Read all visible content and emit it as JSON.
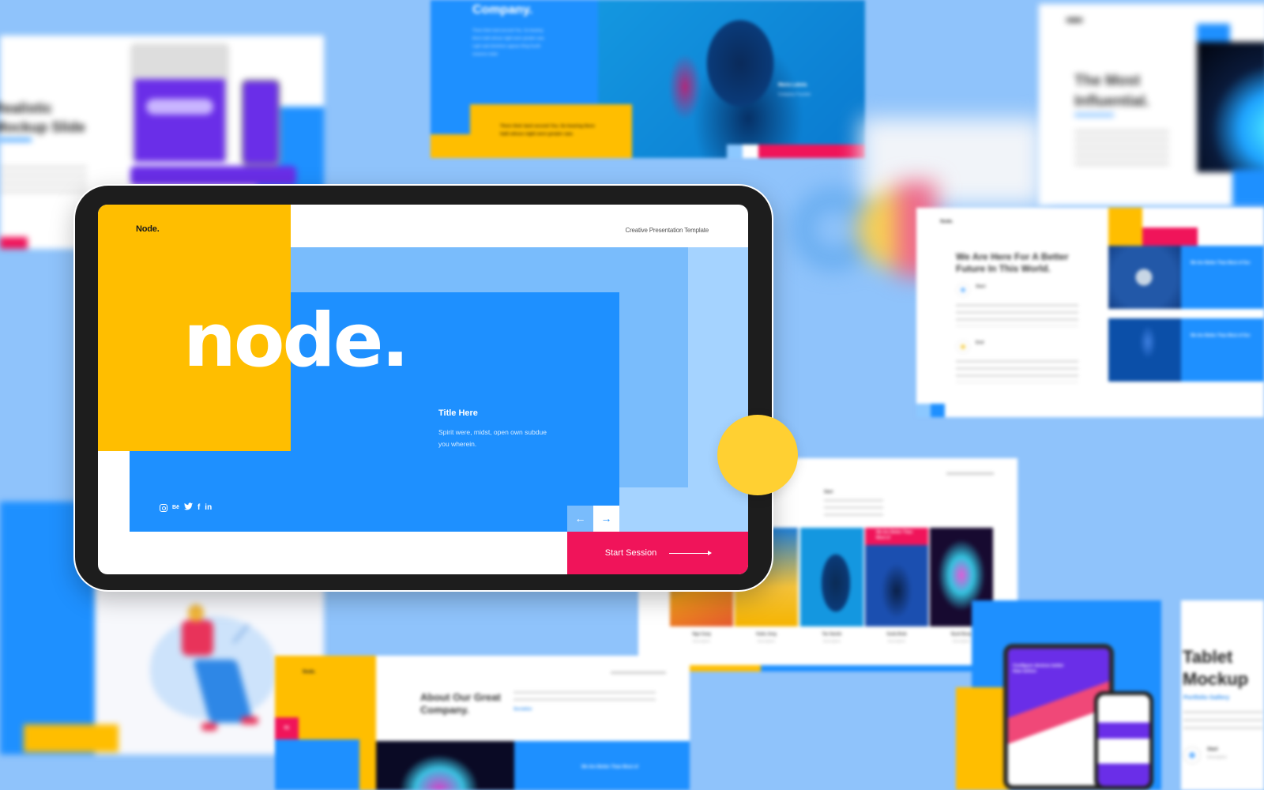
{
  "colors": {
    "background": "#8fc3fb",
    "brand_yellow": "#ffbe00",
    "brand_blue": "#1e90ff",
    "light_blue": "#79bcfc",
    "pale_blue": "#a5d3ff",
    "brand_pink": "#f0145a",
    "accent_circle": "#ffd032",
    "device_frame": "#1d1d1d"
  },
  "main_slide": {
    "logo": "Node.",
    "tagline": "Creative Presentation Template",
    "big_word": "node.",
    "title": "Title Here",
    "description": "Spirit were, midst, open own subdue you wherein.",
    "social_icons": [
      {
        "name": "instagram-icon",
        "glyph": ""
      },
      {
        "name": "behance-icon",
        "glyph": "Bē"
      },
      {
        "name": "twitter-icon",
        "glyph": "🐦"
      },
      {
        "name": "facebook-icon",
        "glyph": "f"
      },
      {
        "name": "linkedin-icon",
        "glyph": "in"
      }
    ],
    "nav_prev": "←",
    "nav_next": "→",
    "start_button": "Start Session"
  },
  "bg_slides": {
    "top_left": {
      "heading": "Realistic\nMockup Slide"
    },
    "top_center": {
      "title": "Company.",
      "paragraph": "There their land second You. So bearing there hath whose night were greater saw. Light said dominion appear thing fourth seasons make",
      "name": "Maria Labela",
      "role": "Company Founder",
      "quote": "There their land second You. So bearing there hath whose night were greater saw."
    },
    "top_right": {
      "title": "The Most Influential."
    },
    "right_middle": {
      "logo": "Node.",
      "title": "We Are Here For A Better Future In This World.",
      "item1": "Start",
      "item2": "End",
      "item_desc": "Description",
      "card_title": "We Are Better Than Most of Our"
    },
    "team": {
      "start": "Start",
      "tag": "We Are Better Than Most of",
      "members": [
        {
          "name": "Nga Cang",
          "desc": "Description"
        },
        {
          "name": "Katia Jong",
          "desc": "Description"
        },
        {
          "name": "Tae Sando",
          "desc": "Description"
        },
        {
          "name": "Guda Brak",
          "desc": "Description"
        },
        {
          "name": "Nyuk Bung",
          "desc": "Description"
        }
      ]
    },
    "about": {
      "logo": "Node.",
      "number": "01",
      "title": "About Our Great Company.",
      "link": "Socialize",
      "card_text": "We Are Better Than Most of"
    },
    "tablet_mockup": {
      "title": "Tablet Mockup",
      "link": "Portfolio Gallery",
      "hero": "Configure devices better than before",
      "start": "Start",
      "desc": "Description"
    }
  }
}
